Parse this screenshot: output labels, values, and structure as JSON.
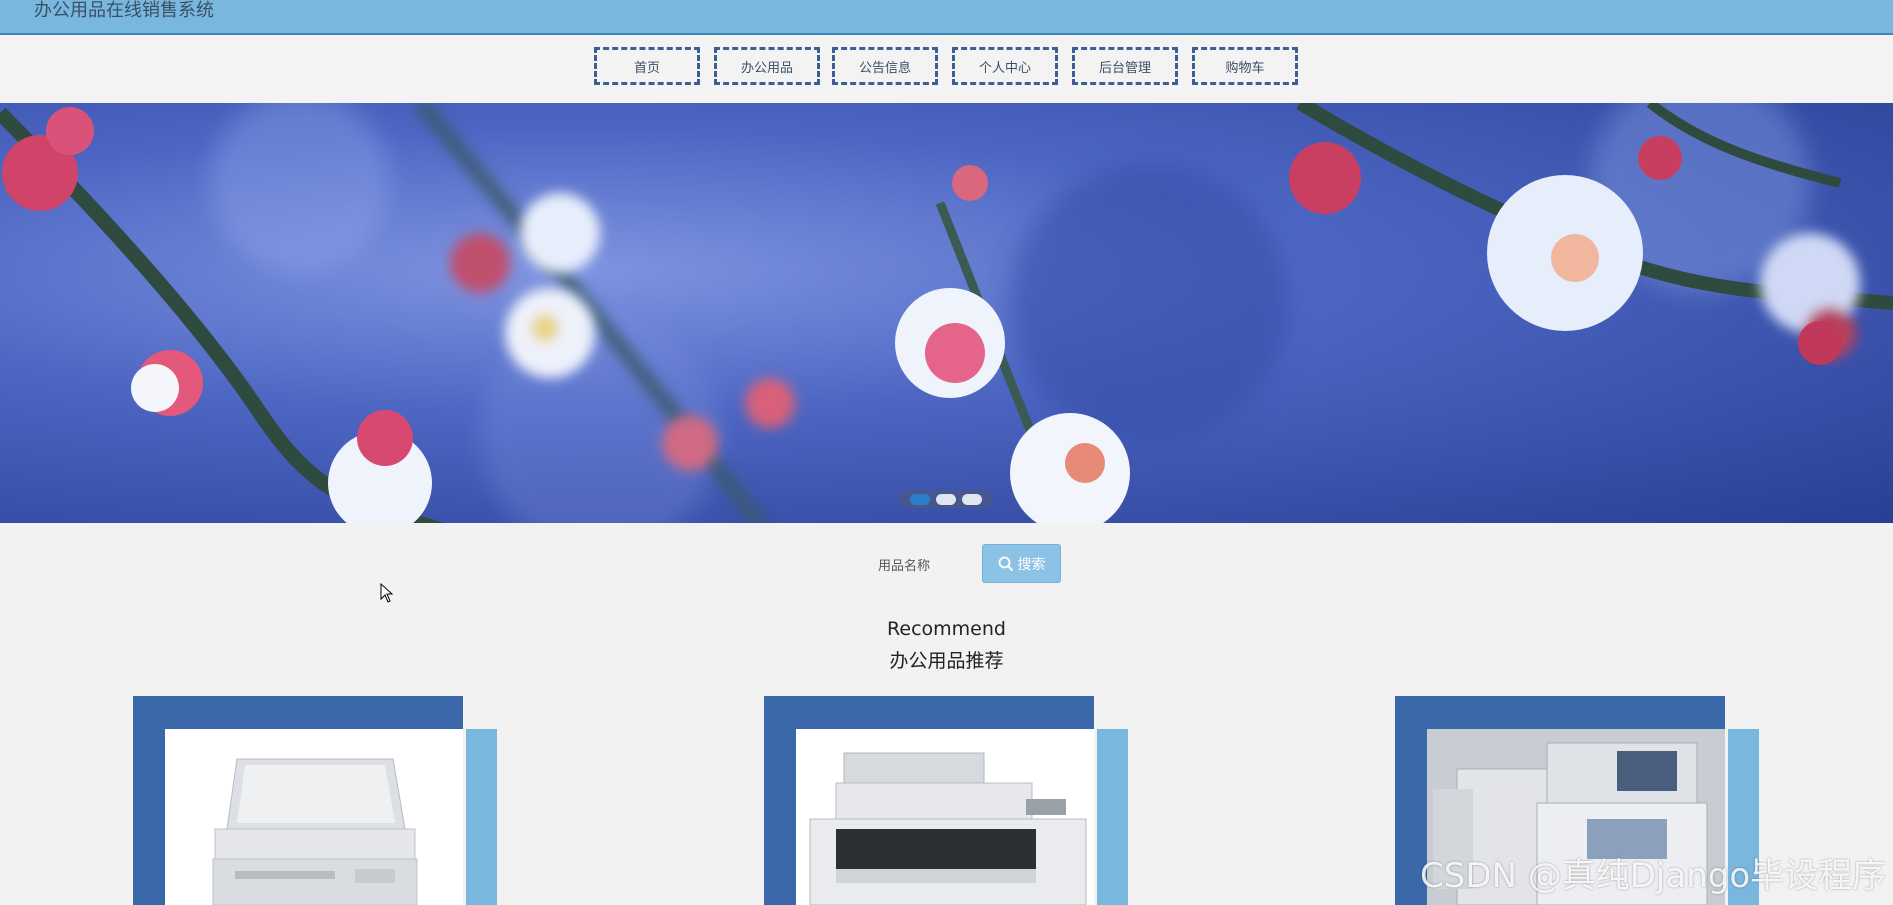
{
  "header": {
    "site_title": "办公用品在线销售系统"
  },
  "nav": {
    "items": [
      "首页",
      "办公用品",
      "公告信息",
      "个人中心",
      "后台管理",
      "购物车"
    ]
  },
  "carousel": {
    "slide_count": 3,
    "active_index": 0
  },
  "search": {
    "field_label": "用品名称",
    "button_label": "搜索"
  },
  "recommend": {
    "title_en": "Recommend",
    "title_cn": "办公用品推荐"
  },
  "products": [
    {
      "image": "copier-white-small"
    },
    {
      "image": "copier-multifunction"
    },
    {
      "image": "copier-large-office"
    }
  ],
  "watermark": "CSDN @真纯Django毕设程序",
  "colors": {
    "topbar": "#78b8de",
    "nav_border": "#3b5f93",
    "card_back": "#3b68a8",
    "card_side": "#7ab7de",
    "search_button": "#8cc2e6"
  }
}
